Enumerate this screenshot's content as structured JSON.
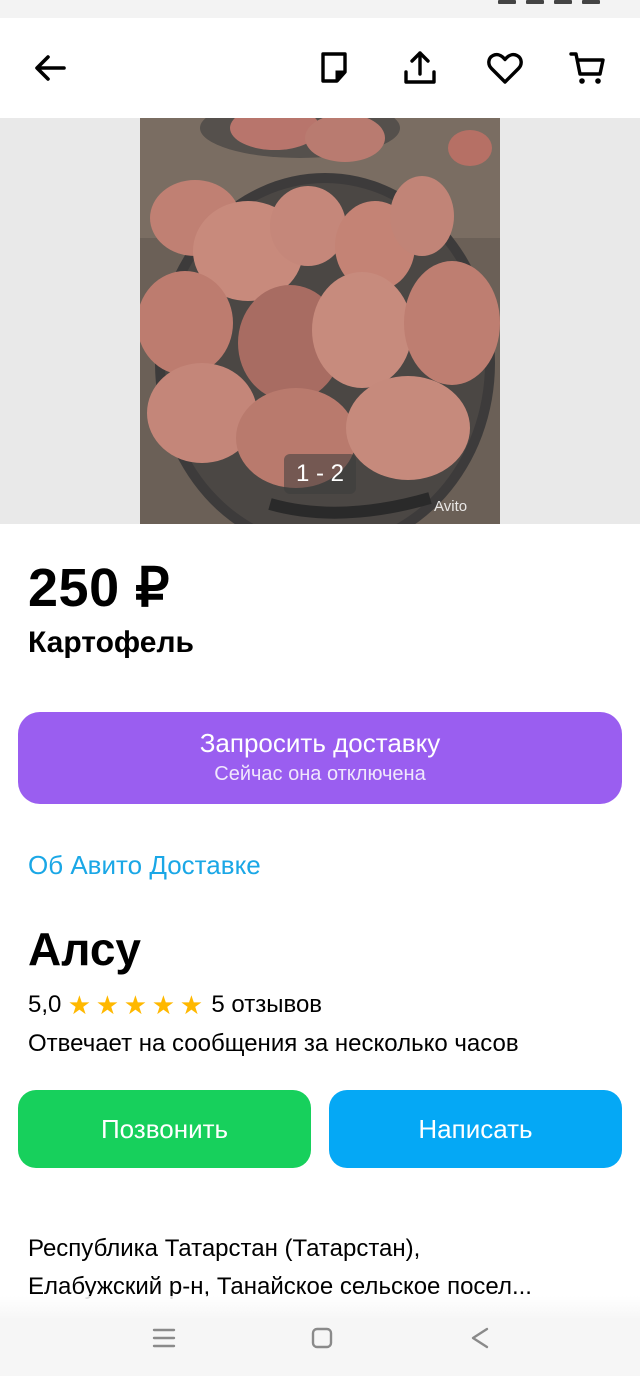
{
  "toolbar": {
    "icons": [
      "back-arrow-icon",
      "notes-icon",
      "share-icon",
      "favorite-heart-icon",
      "cart-icon"
    ]
  },
  "gallery": {
    "counter": "1 - 2",
    "watermark": "Avito"
  },
  "listing": {
    "price": "250 ₽",
    "title": "Картофель"
  },
  "delivery": {
    "button_label": "Запросить доставку",
    "button_sublabel": "Сейчас она отключена",
    "about_link": "Об Авито Доставке"
  },
  "seller": {
    "name": "Алсу",
    "rating": "5,0",
    "stars": 5,
    "reviews": "5 отзывов",
    "reply_time": "Отвечает на сообщения за несколько часов"
  },
  "actions": {
    "call_label": "Позвонить",
    "write_label": "Написать"
  },
  "address": {
    "line1": "Республика Татарстан (Татарстан),",
    "line2": "Елабужский р-н, Танайское сельское посел..."
  },
  "colors": {
    "delivery_button": "#9a5ef0",
    "call_button": "#17d05c",
    "write_button": "#05a8f5",
    "link": "#1aa7e6",
    "star": "#ffb800"
  }
}
